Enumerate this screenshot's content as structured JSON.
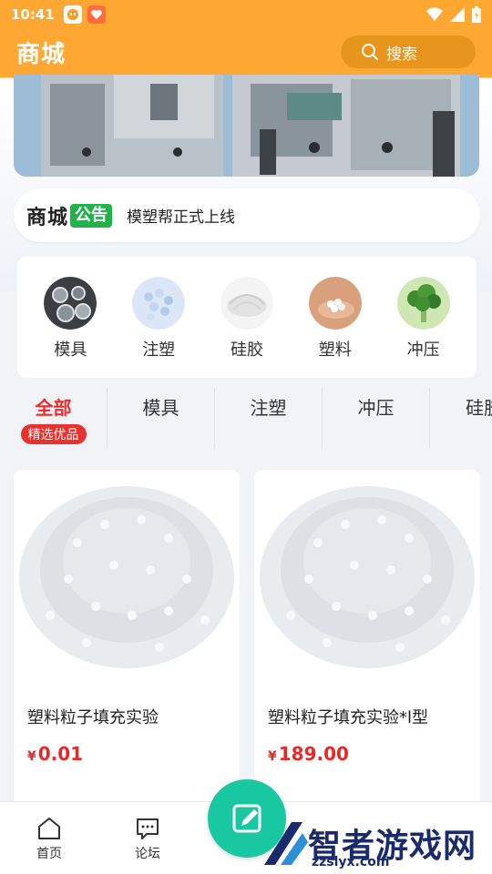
{
  "status_bar": {
    "time": "10:41"
  },
  "header": {
    "title": "商城",
    "search_label": "搜索"
  },
  "notice": {
    "brand": "商城",
    "tag": "公告",
    "text": "模塑帮正式上线"
  },
  "categories": [
    {
      "label": "模具",
      "icon": "mold-pipes-icon"
    },
    {
      "label": "注塑",
      "icon": "pellets-blue-icon"
    },
    {
      "label": "硅胶",
      "icon": "silicone-icon"
    },
    {
      "label": "塑料",
      "icon": "plastic-hand-icon"
    },
    {
      "label": "冲压",
      "icon": "broccoli-icon"
    }
  ],
  "tabs": [
    {
      "label": "全部",
      "badge": "精选优品",
      "active": true
    },
    {
      "label": "模具"
    },
    {
      "label": "注塑"
    },
    {
      "label": "冲压"
    },
    {
      "label": "硅胶"
    }
  ],
  "products": [
    {
      "name": "塑料粒子填充实验",
      "currency": "¥",
      "price": "0.01"
    },
    {
      "name": "塑料粒子填充实验*l型",
      "currency": "¥",
      "price": "189.00"
    }
  ],
  "bottom_nav": [
    {
      "label": "首页",
      "icon": "home-icon"
    },
    {
      "label": "论坛",
      "icon": "chat-icon"
    }
  ],
  "watermark": {
    "text": "智者游戏网",
    "url": "zzslyx.com"
  },
  "colors": {
    "brand_orange": "#ffa733",
    "price_red": "#e82727",
    "notice_green": "#21b34a",
    "publish_teal": "#19c8a0"
  }
}
